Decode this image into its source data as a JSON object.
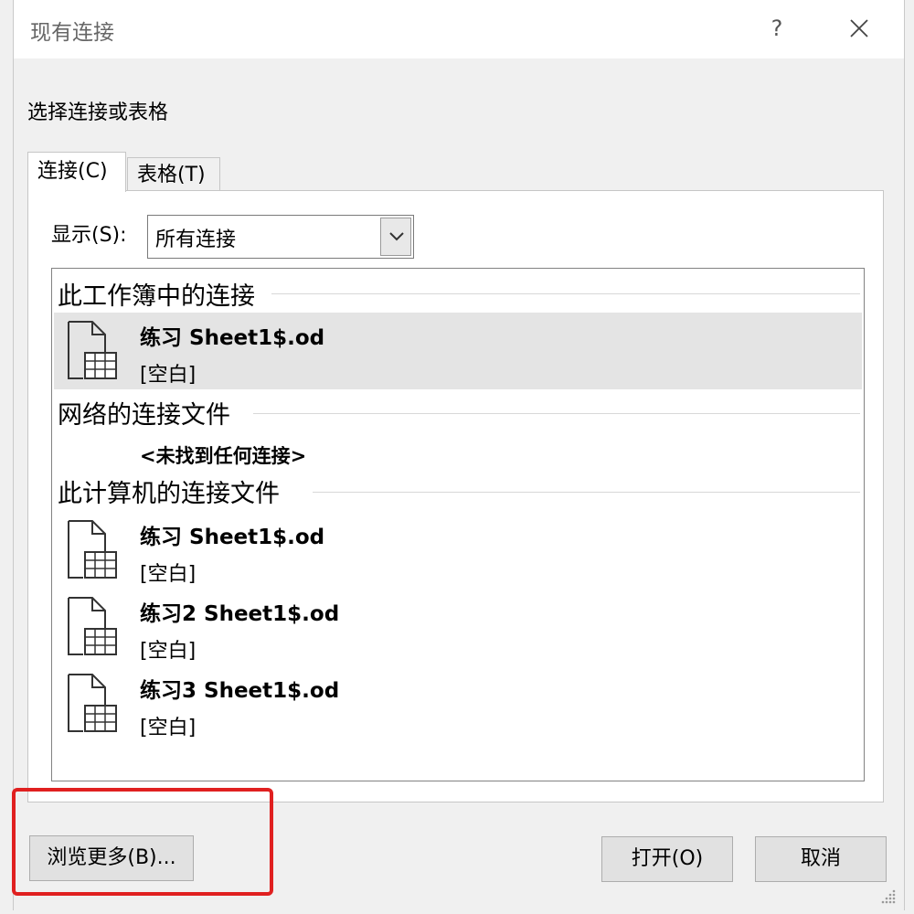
{
  "window": {
    "title": "现有连接",
    "help": "?"
  },
  "prompt": "选择连接或表格",
  "tabs": [
    {
      "label": "连接(C)",
      "mnemonic": "C",
      "active": true
    },
    {
      "label": "表格(T)",
      "mnemonic": "T",
      "active": false
    }
  ],
  "show": {
    "label": "显示(S):",
    "value": "所有连接"
  },
  "groups": [
    {
      "heading": "此工作簿中的连接",
      "items": [
        {
          "name": "练习 Sheet1$.od",
          "desc": "[空白]",
          "selected": true
        }
      ]
    },
    {
      "heading": "网络的连接文件",
      "empty_text": "<未找到任何连接>"
    },
    {
      "heading": "此计算机的连接文件",
      "items": [
        {
          "name": "练习 Sheet1$.od",
          "desc": "[空白]"
        },
        {
          "name": "练习2 Sheet1$.od",
          "desc": "[空白]"
        },
        {
          "name": "练习3 Sheet1$.od",
          "desc": "[空白]"
        }
      ]
    }
  ],
  "buttons": {
    "browse": "浏览更多(B)...",
    "open": "打开(O)",
    "cancel": "取消"
  },
  "colors": {
    "highlight": "#e02020",
    "selected_row": "#e4e4e4"
  },
  "icons": [
    "close-icon",
    "chevron-down-icon",
    "spreadsheet-file-icon",
    "resize-grip-icon"
  ]
}
